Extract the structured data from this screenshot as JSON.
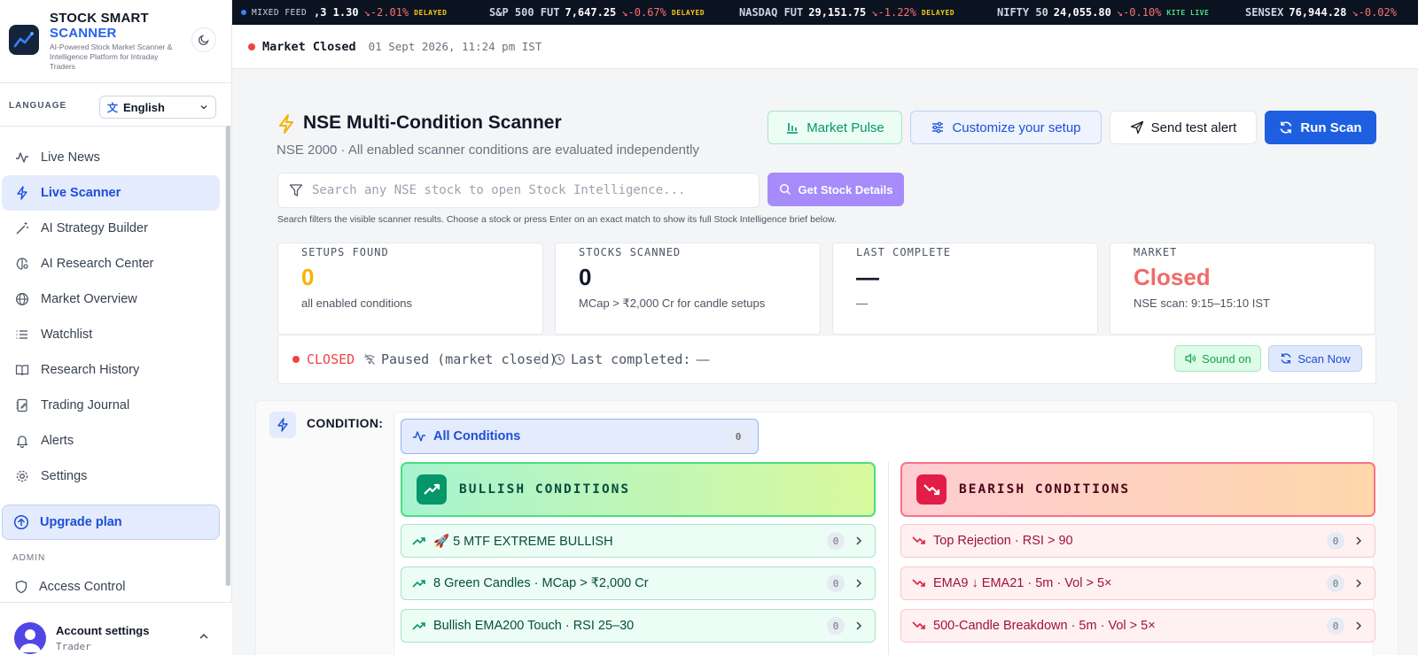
{
  "brand": {
    "title_line1": "STOCK SMART",
    "title_line2": "SCANNER",
    "subtitle": "AI-Powered Stock Market Scanner & Intelligence Platform for Intraday Traders"
  },
  "language": {
    "label": "LANGUAGE",
    "selected": "English"
  },
  "nav": {
    "items": [
      {
        "label": "Live News",
        "icon": "activity-icon"
      },
      {
        "label": "Live Scanner",
        "icon": "lightning-icon",
        "active": true
      },
      {
        "label": "AI Strategy Builder",
        "icon": "magic-wand-icon"
      },
      {
        "label": "AI Research Center",
        "icon": "brain-icon"
      },
      {
        "label": "Market Overview",
        "icon": "globe-icon"
      },
      {
        "label": "Watchlist",
        "icon": "list-icon"
      },
      {
        "label": "Research History",
        "icon": "book-icon"
      },
      {
        "label": "Trading Journal",
        "icon": "journal-icon"
      },
      {
        "label": "Alerts",
        "icon": "bell-icon"
      },
      {
        "label": "Settings",
        "icon": "gear-icon"
      }
    ],
    "upgrade": "Upgrade plan",
    "admin_label": "ADMIN",
    "access_control": "Access Control"
  },
  "account": {
    "name": "Account settings",
    "role": "Trader"
  },
  "ticker": {
    "feed_label": "MIXED FEED",
    "items": [
      {
        "name": "",
        "value": ",3 1.30",
        "change": "-2.01%",
        "tag": "DELAYED"
      },
      {
        "name": "S&P 500 FUT",
        "value": "7,647.25",
        "change": "-0.67%",
        "tag": "DELAYED"
      },
      {
        "name": "NASDAQ FUT",
        "value": "29,151.75",
        "change": "-1.22%",
        "tag": "DELAYED"
      },
      {
        "name": "NIFTY 50",
        "value": "24,055.80",
        "change": "-0.10%",
        "tag": "KITE LIVE"
      },
      {
        "name": "SENSEX",
        "value": "76,944.28",
        "change": "-0.02%",
        "tag": ""
      }
    ]
  },
  "market_status": {
    "label": "Market Closed",
    "time": "01 Sept 2026, 11:24 pm IST"
  },
  "page": {
    "title": "NSE Multi-Condition Scanner",
    "subtitle": "NSE 2000 · All enabled scanner conditions are evaluated independently"
  },
  "actions": {
    "market_pulse": "Market Pulse",
    "customize": "Customize your setup",
    "send_alert": "Send test alert",
    "run_scan": "Run Scan"
  },
  "search": {
    "placeholder": "Search any NSE stock to open Stock Intelligence...",
    "button": "Get Stock Details",
    "hint": "Search filters the visible scanner results. Choose a stock or press Enter on an exact match to show its full Stock Intelligence brief below."
  },
  "stats": [
    {
      "label": "SETUPS FOUND",
      "value": "0",
      "sub": "all enabled conditions",
      "color": "#f5b400"
    },
    {
      "label": "STOCKS SCANNED",
      "value": "0",
      "sub": "MCap > ₹2,000 Cr for candle setups",
      "color": "#111827"
    },
    {
      "label": "LAST COMPLETE",
      "value": "—",
      "sub": "—",
      "color": "#111827"
    },
    {
      "label": "MARKET",
      "value": "Closed",
      "sub": "NSE scan: 9:15–15:10 IST",
      "color": "#f06a6a"
    }
  ],
  "control": {
    "state": "CLOSED",
    "paused": "Paused (market closed)",
    "last_completed": "Last completed:",
    "last_completed_value": "—",
    "sound": "Sound on",
    "scan_now": "Scan Now"
  },
  "conditions": {
    "label": "CONDITION:",
    "all": {
      "label": "All Conditions",
      "count": "0"
    },
    "bullish": {
      "title": "BULLISH CONDITIONS",
      "rows": [
        {
          "label": "🚀 5 MTF EXTREME BULLISH",
          "count": "0"
        },
        {
          "label": "8 Green Candles · MCap > ₹2,000 Cr",
          "count": "0"
        },
        {
          "label": "Bullish EMA200 Touch · RSI 25–30",
          "count": "0"
        }
      ]
    },
    "bearish": {
      "title": "BEARISH CONDITIONS",
      "rows": [
        {
          "label": "Top Rejection · RSI > 90",
          "count": "0"
        },
        {
          "label": "EMA9 ↓ EMA21 · 5m · Vol > 5×",
          "count": "0"
        },
        {
          "label": "500-Candle Breakdown · 5m · Vol > 5×",
          "count": "0"
        }
      ]
    }
  },
  "colors": {
    "accent": "#1d5fe0",
    "bullish": "#059669",
    "bearish": "#e11d48",
    "sidebar_active": "#e3ebfd"
  }
}
